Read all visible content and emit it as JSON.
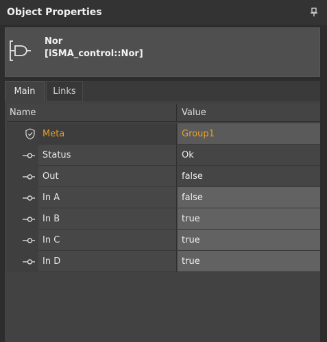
{
  "panel": {
    "title": "Object Properties",
    "pin_icon": "pin-icon"
  },
  "object": {
    "icon": "nor-gate-icon",
    "name": "Nor",
    "type": "[iSMA_control::Nor]"
  },
  "tabs": [
    {
      "label": "Main",
      "active": true
    },
    {
      "label": "Links",
      "active": false
    }
  ],
  "table": {
    "headers": {
      "name": "Name",
      "value": "Value"
    },
    "rows": [
      {
        "name": "Meta",
        "value": "Group1",
        "icon": "shield-icon",
        "kind": "meta"
      },
      {
        "name": "Status",
        "value": "Ok",
        "icon": "slot-icon",
        "kind": "readonly"
      },
      {
        "name": "Out",
        "value": "false",
        "icon": "slot-icon",
        "kind": "readonly"
      },
      {
        "name": "In A",
        "value": "false",
        "icon": "slot-icon",
        "kind": "editable"
      },
      {
        "name": "In B",
        "value": "true",
        "icon": "slot-icon",
        "kind": "editable"
      },
      {
        "name": "In C",
        "value": "true",
        "icon": "slot-icon",
        "kind": "editable"
      },
      {
        "name": "In D",
        "value": "true",
        "icon": "slot-icon",
        "kind": "editable"
      }
    ]
  },
  "colors": {
    "accent": "#e5a127",
    "background": "#2d2d2d",
    "panel": "#424242"
  }
}
